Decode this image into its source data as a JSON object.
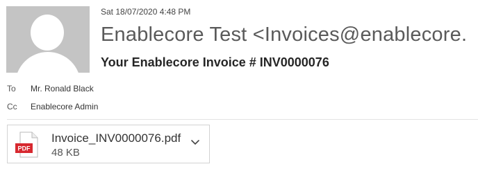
{
  "message": {
    "date": "Sat 18/07/2020 4:48 PM",
    "sender": "Enablecore Test <Invoices@enablecore.",
    "subject": "Your Enablecore Invoice # INV0000076",
    "to_label": "To",
    "to_value": "Mr. Ronald Black",
    "cc_label": "Cc",
    "cc_value": "Enablecore Admin"
  },
  "attachment": {
    "icon": "pdf-file-icon",
    "icon_text": "PDF",
    "name": "Invoice_INV0000076.pdf",
    "size": "48 KB"
  },
  "colors": {
    "pdf_red": "#d7282f",
    "avatar_gray": "#c4c4c4"
  }
}
